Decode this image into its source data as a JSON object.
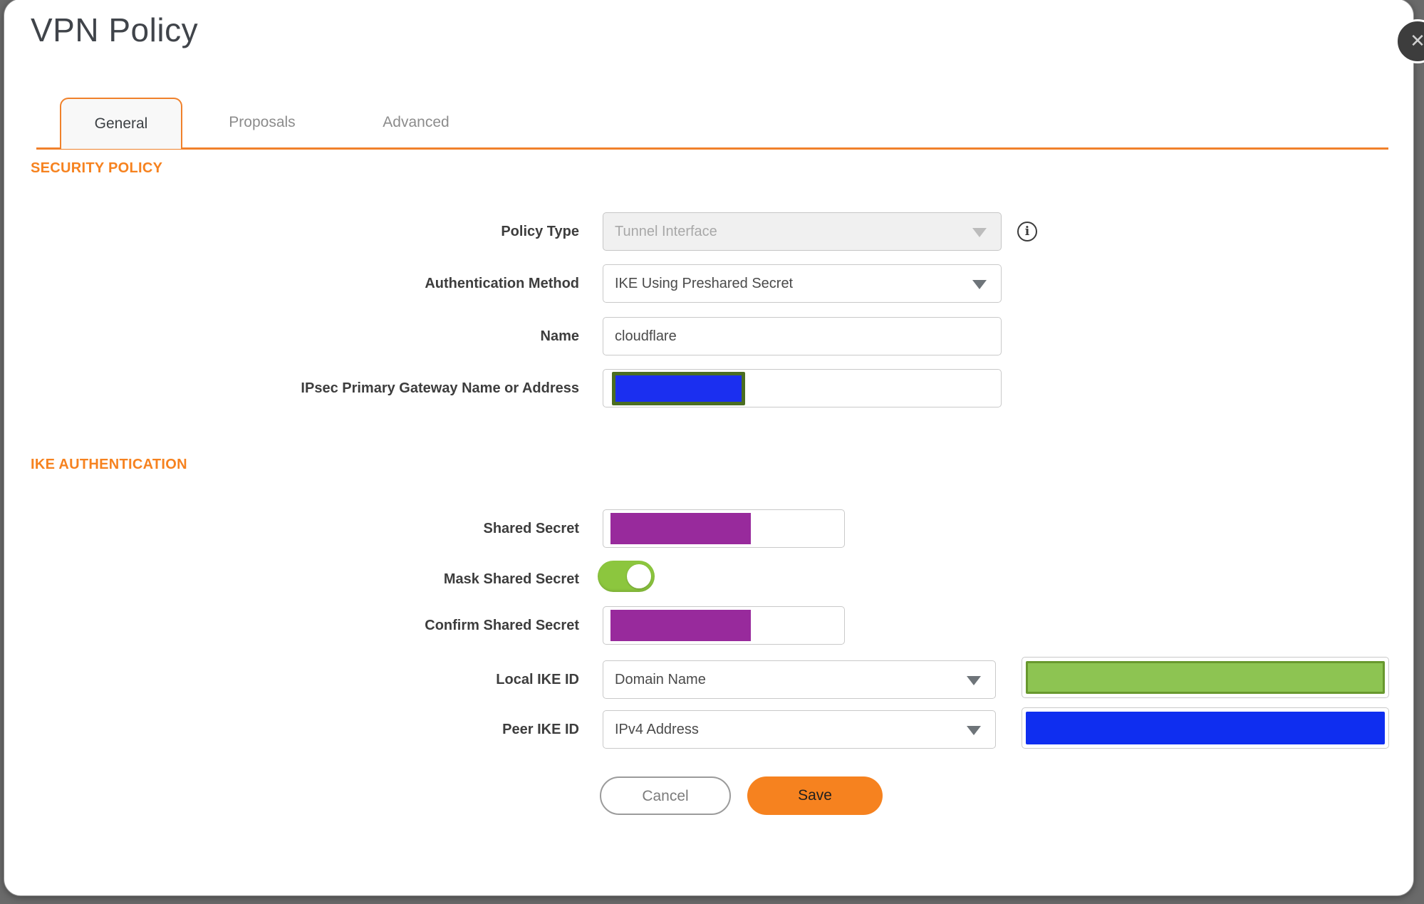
{
  "dialog": {
    "title": "VPN Policy"
  },
  "close": {
    "glyph": "✕"
  },
  "tabs": {
    "general": {
      "label": "General",
      "active": true
    },
    "proposals": {
      "label": "Proposals",
      "active": false
    },
    "advanced": {
      "label": "Advanced",
      "active": false
    }
  },
  "sections": {
    "security_policy": "SECURITY POLICY",
    "ike_authentication": "IKE AUTHENTICATION"
  },
  "form": {
    "policy_type": {
      "label": "Policy Type",
      "value": "Tunnel Interface",
      "disabled": true
    },
    "auth_method": {
      "label": "Authentication Method",
      "value": "IKE Using Preshared Secret"
    },
    "name": {
      "label": "Name",
      "value": "cloudflare"
    },
    "gateway": {
      "label": "IPsec Primary Gateway Name or Address",
      "value": "",
      "redaction": "blue-block-green-border"
    },
    "shared_secret": {
      "label": "Shared Secret",
      "redaction": "purple-block"
    },
    "mask_shared_secret": {
      "label": "Mask Shared Secret",
      "state": "on"
    },
    "confirm_shared_secret": {
      "label": "Confirm Shared Secret",
      "redaction": "purple-block"
    },
    "local_ike_id": {
      "label": "Local IKE ID",
      "value": "Domain Name",
      "redaction": "green-block"
    },
    "peer_ike_id": {
      "label": "Peer IKE ID",
      "value": "IPv4 Address",
      "redaction": "blue-block"
    }
  },
  "info_icon": {
    "glyph": "i"
  },
  "buttons": {
    "cancel": "Cancel",
    "save": "Save"
  },
  "colors": {
    "accent_orange": "#f6821f",
    "tab_line_orange": "#f0812b",
    "toggle_green": "#8cc63e",
    "redact_purple": "#982a9c",
    "redact_blue": "#1b2ff0",
    "redact_blue_border": "#4b6e22",
    "redact_green_fill": "#8dc452",
    "redact_green_border": "#68982e",
    "backdrop_gray": "#6a6a6a",
    "close_circle": "#3d3d3d"
  }
}
